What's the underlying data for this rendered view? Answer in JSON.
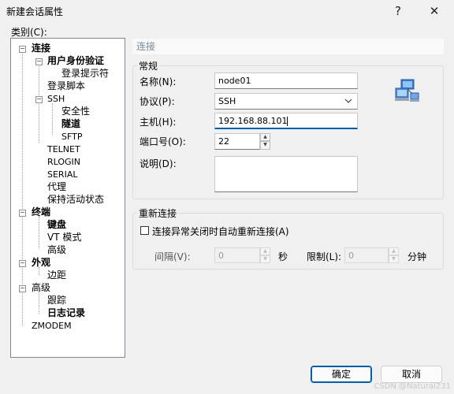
{
  "window": {
    "title": "新建会话属性",
    "help_glyph": "?",
    "close_glyph": "✕"
  },
  "category_label": "类别(C):",
  "tree": {
    "expander_glyph": "−",
    "items": [
      {
        "label": "连接"
      },
      {
        "label": "用户身份验证"
      },
      {
        "label": "登录提示符"
      },
      {
        "label": "登录脚本"
      },
      {
        "label": "SSH"
      },
      {
        "label": "安全性"
      },
      {
        "label": "隧道"
      },
      {
        "label": "SFTP"
      },
      {
        "label": "TELNET"
      },
      {
        "label": "RLOGIN"
      },
      {
        "label": "SERIAL"
      },
      {
        "label": "代理"
      },
      {
        "label": "保持活动状态"
      },
      {
        "label": "终端"
      },
      {
        "label": "键盘"
      },
      {
        "label": "VT 模式"
      },
      {
        "label": "高级"
      },
      {
        "label": "外观"
      },
      {
        "label": "边距"
      },
      {
        "label": "高级"
      },
      {
        "label": "跟踪"
      },
      {
        "label": "日志记录"
      },
      {
        "label": "ZMODEM"
      }
    ]
  },
  "section_header": "连接",
  "general": {
    "title": "常规",
    "name_label": "名称(N):",
    "name_value": "node01",
    "protocol_label": "协议(P):",
    "protocol_value": "SSH",
    "host_label": "主机(H):",
    "host_value": "192.168.88.101",
    "port_label": "端口号(O):",
    "port_value": "22",
    "desc_label": "说明(D):",
    "desc_value": ""
  },
  "reconnect": {
    "title": "重新连接",
    "checkbox_label": "连接异常关闭时自动重新连接(A)",
    "interval_label": "间隔(V):",
    "interval_value": "0",
    "interval_unit": "秒",
    "limit_label": "限制(L):",
    "limit_value": "0",
    "limit_unit": "分钟"
  },
  "buttons": {
    "ok": "确定",
    "cancel": "取消"
  },
  "icons": {
    "network": "network-computers-icon",
    "dropdown": "chevron-down-icon",
    "spin_up": "▲",
    "spin_down": "▼"
  },
  "watermark": "CSDN @Natural231"
}
